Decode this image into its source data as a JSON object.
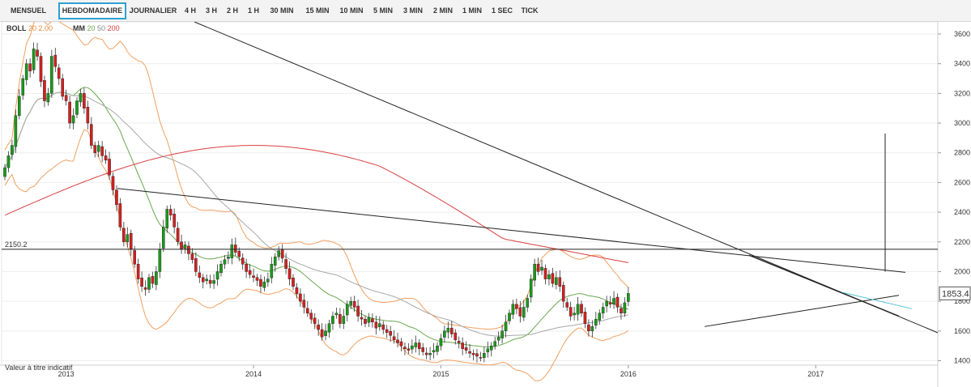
{
  "toolbar": {
    "tabs": [
      "MENSUEL",
      "HEBDOMADAIRE",
      "JOURNALIER",
      "4 H",
      "3 H",
      "2 H",
      "1 H",
      "30 MIN",
      "15 MIN",
      "10 MIN",
      "5 MIN",
      "3 MIN",
      "2 MIN",
      "1 MIN",
      "1 SEC",
      "TICK"
    ],
    "active_tab": "HEBDOMADAIRE"
  },
  "legend": {
    "boll_label": "BOLL",
    "boll_period": "20",
    "boll_mult": "2.00",
    "mm_label": "MM",
    "mm_1": "20",
    "mm_2": "50",
    "mm_3": "200"
  },
  "colors": {
    "up": "#1a9a1a",
    "down": "#d42020",
    "boll": "#f0a060",
    "mm20": "#6aa84f",
    "mm50": "#a8a8a8",
    "mm200": "#d94040",
    "trend": "#222222",
    "cyan_line": "#4fc3d8"
  },
  "footer_note": "Valeur à titre indicatif",
  "chart_data": {
    "type": "candlestick",
    "timeframe": "weekly",
    "ylim": [
      1370,
      3660
    ],
    "yticks": [
      1400,
      1600,
      1800,
      2000,
      2200,
      2400,
      2600,
      2800,
      3000,
      3200,
      3400,
      3600
    ],
    "ytick_labels": [
      "1400.0",
      "1600.0",
      "1800.0",
      "2000.0",
      "2200.0",
      "2400.0",
      "2600.0",
      "2800.0",
      "3000.0",
      "3200.0",
      "3400.0",
      "3600.0"
    ],
    "x_labels": [
      {
        "label": "2013",
        "week": 17
      },
      {
        "label": "2014",
        "week": 69
      },
      {
        "label": "2015",
        "week": 121
      },
      {
        "label": "2016",
        "week": 173
      },
      {
        "label": "2017",
        "week": 225
      }
    ],
    "horizontal_level": {
      "value": 2150.2,
      "label": "2150.2"
    },
    "last_price": {
      "value": 1853.4,
      "label": "1853.4"
    },
    "candles": [
      2700,
      2780,
      2850,
      3050,
      3180,
      3300,
      3400,
      3350,
      3500,
      3450,
      3280,
      3150,
      3200,
      3450,
      3380,
      3300,
      3180,
      3150,
      3000,
      3050,
      3150,
      3200,
      3100,
      3000,
      2850,
      2800,
      2850,
      2780,
      2750,
      2650,
      2550,
      2450,
      2300,
      2200,
      2250,
      2150,
      2050,
      1950,
      1900,
      1880,
      1960,
      1920,
      2000,
      2150,
      2300,
      2420,
      2380,
      2300,
      2200,
      2150,
      2180,
      2120,
      2080,
      2000,
      1960,
      1930,
      1950,
      1920,
      1940,
      2000,
      2050,
      2080,
      2100,
      2180,
      2130,
      2100,
      2050,
      2000,
      1980,
      1960,
      1940,
      1900,
      1930,
      1950,
      2050,
      2100,
      2140,
      2090,
      2020,
      1950,
      1900,
      1850,
      1800,
      1760,
      1720,
      1680,
      1650,
      1610,
      1560,
      1600,
      1650,
      1700,
      1720,
      1650,
      1700,
      1780,
      1800,
      1760,
      1700,
      1680,
      1650,
      1690,
      1660,
      1620,
      1650,
      1610,
      1590,
      1570,
      1540,
      1520,
      1500,
      1480,
      1470,
      1500,
      1520,
      1480,
      1460,
      1440,
      1450,
      1470,
      1500,
      1550,
      1600,
      1620,
      1580,
      1540,
      1520,
      1480,
      1470,
      1450,
      1440,
      1430,
      1420,
      1450,
      1480,
      1500,
      1530,
      1560,
      1600,
      1660,
      1720,
      1780,
      1750,
      1700,
      1760,
      1820,
      1950,
      2050,
      2000,
      2030,
      1950,
      1980,
      1920,
      1960,
      1900,
      1800,
      1760,
      1700,
      1720,
      1780,
      1720,
      1650,
      1600,
      1630,
      1680,
      1720,
      1760,
      1800,
      1780,
      1820,
      1760,
      1720,
      1790,
      1853
    ]
  }
}
